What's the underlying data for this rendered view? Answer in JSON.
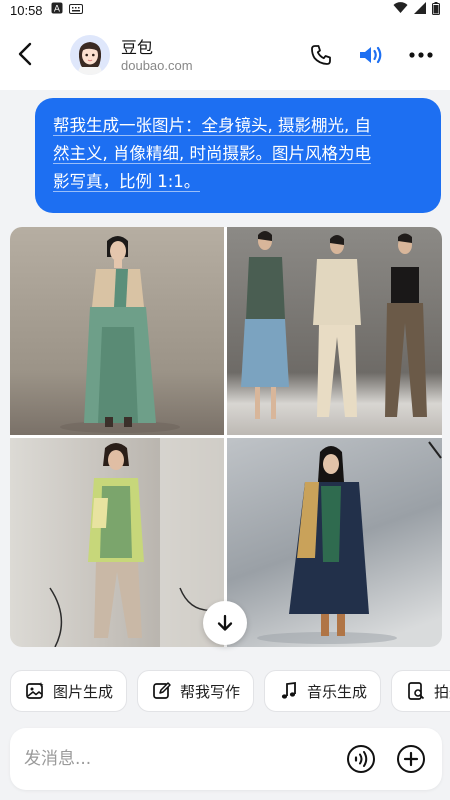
{
  "status_bar": {
    "time": "10:58",
    "icons": [
      "a-icon",
      "keyboard-icon",
      "wifi-icon",
      "signal-icon",
      "battery-icon"
    ]
  },
  "header": {
    "back_icon": "chevron-left-icon",
    "contact_name": "豆包",
    "contact_domain": "doubao.com",
    "actions": [
      "phone-icon",
      "speaker-icon",
      "more-icon"
    ]
  },
  "chat": {
    "user_message_lines": [
      "帮我生成一张图片：全身镜头, 摄影棚光, 自",
      "然主义, 肖像精细, 时尚摄影。图片风格为电",
      "影写真，比例 1:1。"
    ],
    "generated_images": [
      "fashion-photo-1",
      "fashion-photo-2",
      "fashion-photo-3",
      "fashion-photo-4"
    ],
    "scroll_icon": "arrow-down-icon"
  },
  "quick_actions": [
    {
      "label": "图片生成",
      "icon": "image-gen-icon"
    },
    {
      "label": "帮我写作",
      "icon": "edit-icon"
    },
    {
      "label": "音乐生成",
      "icon": "music-icon"
    },
    {
      "label": "拍题",
      "icon": "scan-icon"
    }
  ],
  "input": {
    "placeholder": "发消息..."
  },
  "colors": {
    "accent": "#1d6ff2",
    "background": "#f2f3f5"
  }
}
